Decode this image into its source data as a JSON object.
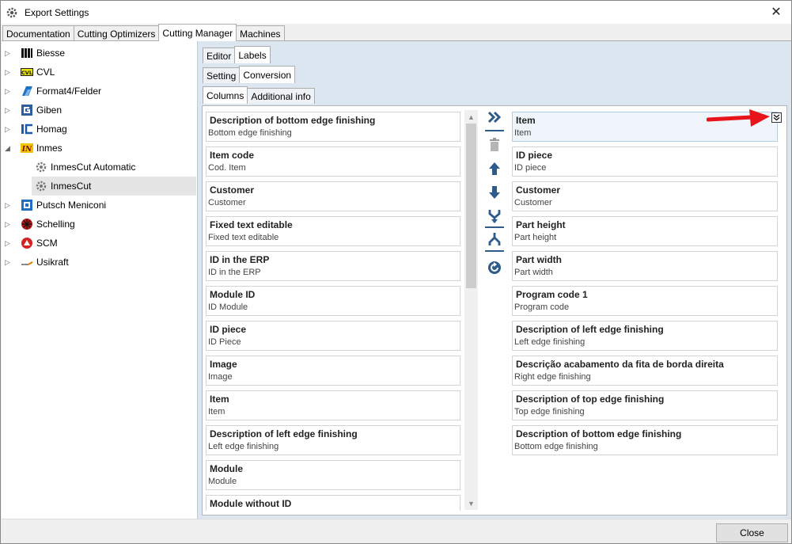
{
  "window": {
    "title": "Export Settings"
  },
  "top_tabs": [
    "Documentation",
    "Cutting Optimizers",
    "Cutting Manager",
    "Machines"
  ],
  "tree": [
    {
      "label": "Biesse",
      "icon": "biesse-logo-icon",
      "expander": "▷"
    },
    {
      "label": "CVL",
      "icon": "cvl-logo-icon",
      "expander": "▷"
    },
    {
      "label": "Format4/Felder",
      "icon": "format4-logo-icon",
      "expander": "▷"
    },
    {
      "label": "Giben",
      "icon": "giben-logo-icon",
      "expander": "▷"
    },
    {
      "label": "Homag",
      "icon": "homag-logo-icon",
      "expander": "▷"
    },
    {
      "label": "Inmes",
      "icon": "inmes-logo-icon",
      "expander": "◢"
    },
    {
      "label": "InmesCut Automatic",
      "icon": "gear-icon",
      "expander": ""
    },
    {
      "label": "InmesCut",
      "icon": "gear-icon",
      "expander": ""
    },
    {
      "label": "Putsch Meniconi",
      "icon": "putsch-logo-icon",
      "expander": "▷"
    },
    {
      "label": "Schelling",
      "icon": "schelling-logo-icon",
      "expander": "▷"
    },
    {
      "label": "SCM",
      "icon": "scm-logo-icon",
      "expander": "▷"
    },
    {
      "label": "Usikraft",
      "icon": "usikraft-logo-icon",
      "expander": "▷"
    }
  ],
  "editor_tabs": [
    "Editor",
    "Labels"
  ],
  "labels_tabs": [
    "Setting",
    "Conversion"
  ],
  "conversion_tabs": [
    "Columns",
    "Additional info"
  ],
  "available_columns": [
    {
      "title": "Description of bottom edge finishing",
      "sub": "Bottom edge finishing"
    },
    {
      "title": "Item code",
      "sub": "Cod. Item"
    },
    {
      "title": "Customer",
      "sub": "Customer"
    },
    {
      "title": "Fixed text editable",
      "sub": "Fixed text editable"
    },
    {
      "title": "ID in the ERP",
      "sub": "ID in the ERP"
    },
    {
      "title": "Module ID",
      "sub": "ID Module"
    },
    {
      "title": "ID piece",
      "sub": "ID Piece"
    },
    {
      "title": "Image",
      "sub": "Image"
    },
    {
      "title": "Item",
      "sub": "Item"
    },
    {
      "title": "Description of left edge finishing",
      "sub": "Left edge finishing"
    },
    {
      "title": "Module",
      "sub": "Module"
    },
    {
      "title": "Module without ID",
      "sub": ""
    }
  ],
  "selected_columns": [
    {
      "title": "Item",
      "sub": "Item"
    },
    {
      "title": "ID piece",
      "sub": "ID piece"
    },
    {
      "title": "Customer",
      "sub": "Customer"
    },
    {
      "title": "Part height",
      "sub": "Part height"
    },
    {
      "title": "Part width",
      "sub": "Part width"
    },
    {
      "title": "Program code 1",
      "sub": "Program code"
    },
    {
      "title": "Description of left edge finishing",
      "sub": "Left edge finishing"
    },
    {
      "title": "Descrição acabamento da fita de borda direita",
      "sub": "Right edge finishing"
    },
    {
      "title": "Description of top edge finishing",
      "sub": "Top edge finishing"
    },
    {
      "title": "Description of bottom edge finishing",
      "sub": "Bottom edge finishing"
    }
  ],
  "toolbar": [
    {
      "name": "add-all-button",
      "icon": "double-chevron-right-icon"
    },
    {
      "name": "delete-button",
      "icon": "trash-icon"
    },
    {
      "name": "move-up-button",
      "icon": "arrow-up-icon"
    },
    {
      "name": "move-down-button",
      "icon": "arrow-down-icon"
    },
    {
      "name": "merge-button",
      "icon": "merge-icon"
    },
    {
      "name": "split-button",
      "icon": "split-icon"
    },
    {
      "name": "reset-button",
      "icon": "refresh-icon"
    }
  ],
  "buttons": {
    "close": "Close"
  },
  "colors": {
    "accent": "#2e5b8a",
    "annotation_arrow": "#e8141b"
  }
}
